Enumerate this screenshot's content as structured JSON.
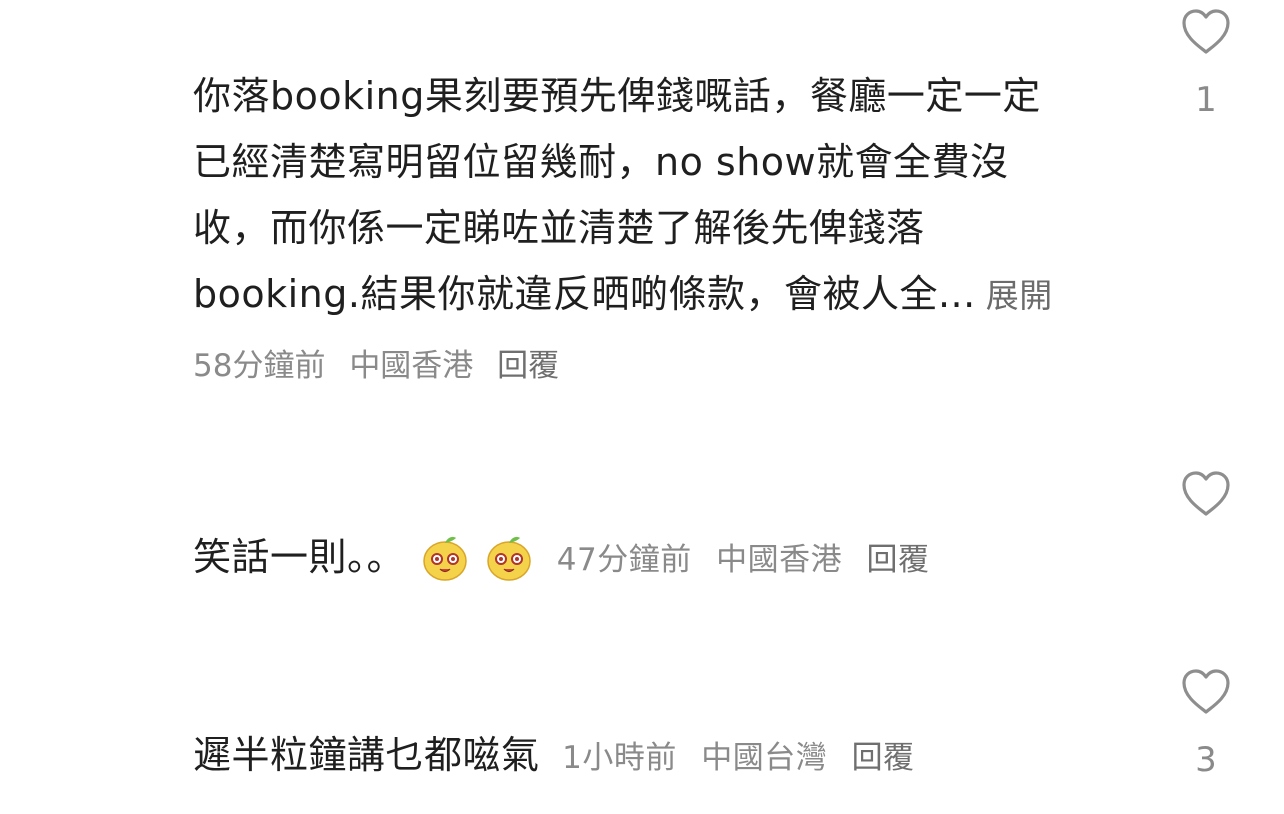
{
  "comments": [
    {
      "lines": [
        "你落booking果刻要預先俾錢嘅話，餐廳一定一定",
        "已經清楚寫明留位留幾耐，no show就會全費沒",
        "收，而你係一定睇咗並清楚了解後先俾錢落",
        "booking.結果你就違反晒啲條款，會被人全..."
      ],
      "expand_label": "展開",
      "time": "58分鐘前",
      "location": "中國香港",
      "reply_label": "回覆",
      "likes": "1"
    },
    {
      "text": "笑話一則。。",
      "emoji_icons": [
        "mango-face-emoji",
        "mango-face-emoji"
      ],
      "time": "47分鐘前",
      "location": "中國香港",
      "reply_label": "回覆",
      "likes": ""
    },
    {
      "text": "遲半粒鐘講乜都嗞氣",
      "time": "1小時前",
      "location": "中國台灣",
      "reply_label": "回覆",
      "likes": "3"
    }
  ],
  "colors": {
    "text": "#1f1f1f",
    "meta": "#8a8a8a",
    "icon_stroke": "#8e8e8e"
  }
}
